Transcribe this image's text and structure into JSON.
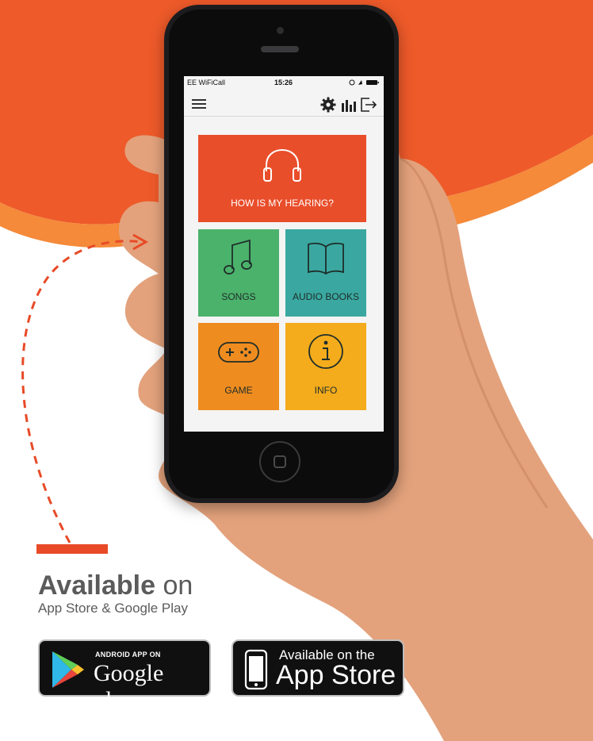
{
  "phone": {
    "status": {
      "carrier": "EE WiFiCall",
      "time": "15:26"
    },
    "tiles": [
      {
        "label": "HOW IS MY HEARING?",
        "icon": "headphones-icon",
        "color": "#e94e2b"
      },
      {
        "label": "SONGS",
        "icon": "music-note-icon",
        "color": "#4bb26b"
      },
      {
        "label": "AUDIO BOOKS",
        "icon": "book-icon",
        "color": "#3aa8a0"
      },
      {
        "label": "GAME",
        "icon": "gamepad-icon",
        "color": "#ef8c1f"
      },
      {
        "label": "INFO",
        "icon": "info-icon",
        "color": "#f4ac1c"
      }
    ]
  },
  "promo": {
    "available_bold": "Available",
    "available_on": "on",
    "stores_line": "App Store & Google Play"
  },
  "badges": {
    "google": {
      "small": "ANDROID APP ON",
      "big": "Google play"
    },
    "apple": {
      "small": "Available on the",
      "big": "App Store"
    }
  },
  "colors": {
    "accent": "#e84a27",
    "background": "#ffffff"
  }
}
